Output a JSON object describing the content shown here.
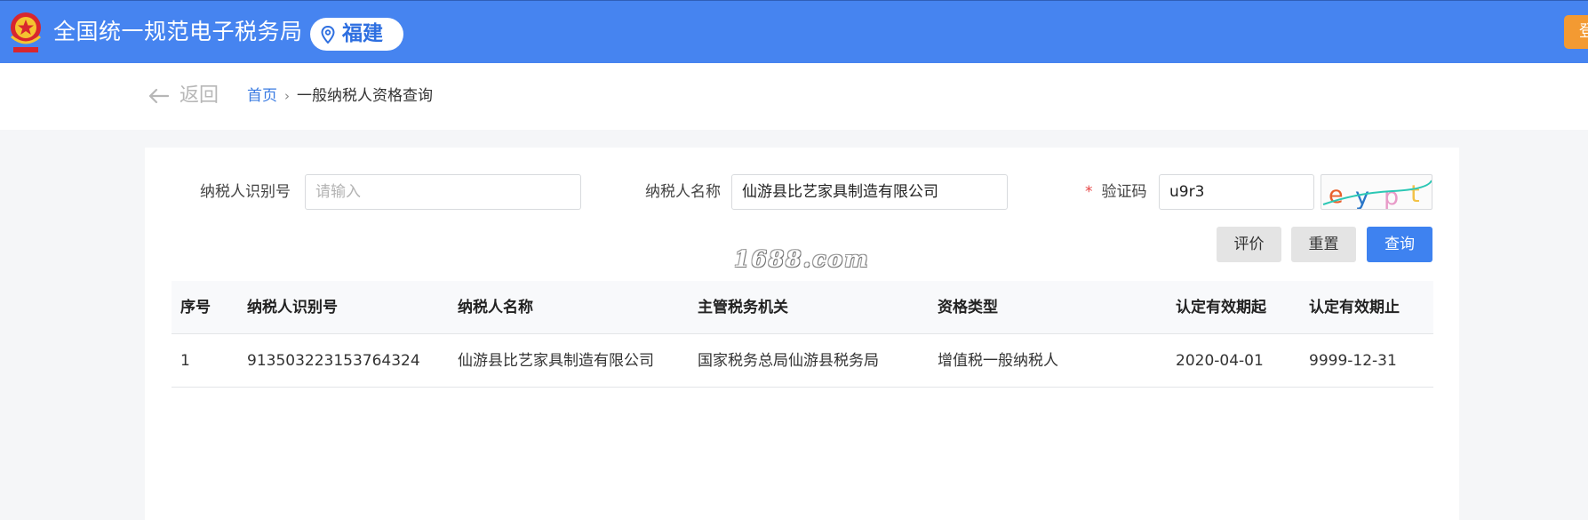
{
  "header": {
    "site_title": "全国统一规范电子税务局",
    "region": "福建",
    "login_label": "登",
    "colors": {
      "bar": "#4684f0",
      "login": "#f39a32",
      "region_text": "#2e6fe0"
    }
  },
  "nav": {
    "back_label": "返回",
    "breadcrumb": {
      "home": "首页",
      "separator": "›",
      "current": "一般纳税人资格查询"
    }
  },
  "form": {
    "taxpayer_id": {
      "label": "纳税人识别号",
      "value": "",
      "placeholder": "请输入"
    },
    "taxpayer_name": {
      "label": "纳税人名称",
      "value": "仙游县比艺家具制造有限公司"
    },
    "captcha": {
      "required_mark": "*",
      "label": "验证码",
      "value": "u9r3",
      "image_text": "eypt"
    },
    "buttons": {
      "rate": "评价",
      "reset": "重置",
      "query": "查询"
    }
  },
  "watermark": "1688.com",
  "table": {
    "columns": [
      "序号",
      "纳税人识别号",
      "纳税人名称",
      "主管税务机关",
      "资格类型",
      "认定有效期起",
      "认定有效期止"
    ],
    "rows": [
      [
        "1",
        "913503223153764324",
        "仙游县比艺家具制造有限公司",
        "国家税务总局仙游县税务局",
        "增值税一般纳税人",
        "2020-04-01",
        "9999-12-31"
      ]
    ]
  }
}
